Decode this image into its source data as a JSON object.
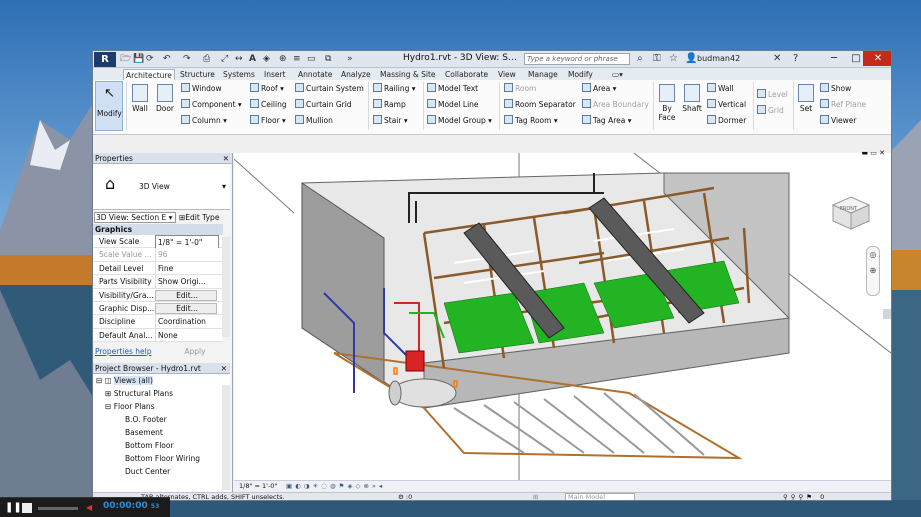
{
  "window": {
    "title": "Hydro1.rvt - 3D View: Se...",
    "search_placeholder": "Type a keyword or phrase",
    "user": "budman42"
  },
  "tabs": [
    "Architecture",
    "Structure",
    "Systems",
    "Insert",
    "Annotate",
    "Analyze",
    "Massing & Site",
    "Collaborate",
    "View",
    "Manage",
    "Modify"
  ],
  "ribbon": {
    "modify": "Modify",
    "wall": "Wall",
    "door": "Door",
    "window": "Window",
    "component": "Component",
    "column": "Column",
    "roof": "Roof",
    "ceiling": "Ceiling",
    "floor": "Floor",
    "curtain_system": "Curtain System",
    "curtain_grid": "Curtain Grid",
    "mullion": "Mullion",
    "railing": "Railing",
    "ramp": "Ramp",
    "stair": "Stair",
    "model_text": "Model Text",
    "model_line": "Model Line",
    "model_group": "Model Group",
    "room": "Room",
    "room_separator": "Room Separator",
    "tag_room": "Tag Room",
    "area": "Area",
    "area_boundary": "Area Boundary",
    "tag_area": "Tag Area",
    "by_face": "By Face",
    "shaft": "Shaft",
    "r_wall": "Wall",
    "vertical": "Vertical",
    "dormer": "Dormer",
    "level": "Level",
    "grid": "Grid",
    "set": "Set",
    "show": "Show",
    "ref_plane": "Ref Plane",
    "viewer": "Viewer"
  },
  "properties": {
    "header": "Properties",
    "type_name": "3D View",
    "instance_selector": "3D View: Section E",
    "edit_type": "Edit Type",
    "section": "Graphics",
    "rows": [
      {
        "key": "View Scale",
        "value": "1/8\" = 1'-0\""
      },
      {
        "key": "Scale Value ...",
        "value": "96"
      },
      {
        "key": "Detail Level",
        "value": "Fine"
      },
      {
        "key": "Parts Visibility",
        "value": "Show Origi..."
      },
      {
        "key": "Visibility/Gra...",
        "value": "Edit..."
      },
      {
        "key": "Graphic Disp...",
        "value": "Edit..."
      },
      {
        "key": "Discipline",
        "value": "Coordination"
      },
      {
        "key": "Default Anal...",
        "value": "None"
      }
    ],
    "help": "Properties help",
    "apply": "Apply"
  },
  "project_browser": {
    "header": "Project Browser - Hydro1.rvt",
    "items": [
      {
        "label": "Views (all)"
      },
      {
        "label": "Structural Plans"
      },
      {
        "label": "Floor Plans"
      },
      {
        "label": "B.O. Footer"
      },
      {
        "label": "Basement"
      },
      {
        "label": "Bottom Floor"
      },
      {
        "label": "Bottom Floor Wiring"
      },
      {
        "label": "Duct Center"
      }
    ]
  },
  "viewport": {
    "scale": "1/8\" = 1'-0\"",
    "viewcube_face": "FRONT"
  },
  "statusbar": {
    "message": "TAB alternates, CTRL adds, SHIFT unselects.",
    "model": "Main Model"
  },
  "player": {
    "time": "00:00:00",
    "sub": "53"
  },
  "colors": {
    "accent": "#1d3c6e",
    "pipe_green": "#22b422",
    "beam_brown": "#8b5a2b",
    "close_red": "#c42b1c"
  }
}
